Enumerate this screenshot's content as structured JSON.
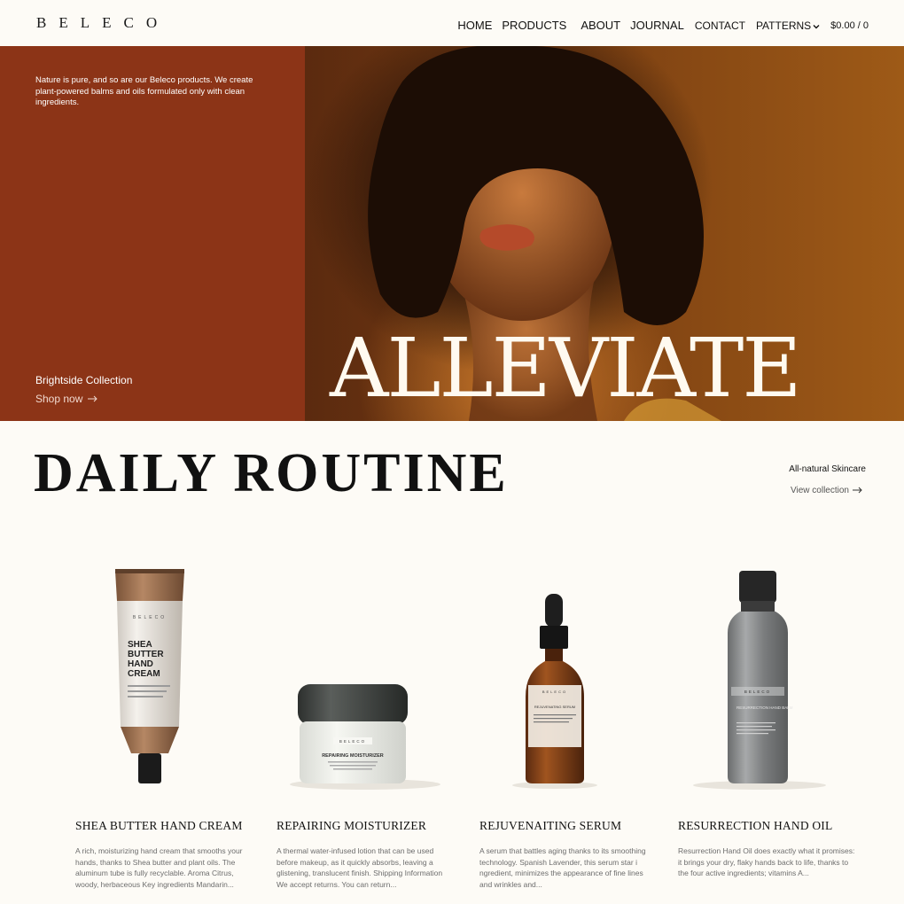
{
  "header": {
    "logo": "BELECO",
    "nav": [
      "HOME",
      "PRODUCTS",
      "ABOUT",
      "JOURNAL",
      "CONTACT",
      "PATTERNS"
    ],
    "cart": "$0.00 / 0"
  },
  "hero": {
    "description": "Nature is pure, and so are our Beleco products. We create plant-powered balms and oils formulated only with clean ingredients.",
    "collection": "Brightside Collection",
    "shop_label": "Shop now",
    "title": "ALLEVIATE"
  },
  "section": {
    "title": "DAILY ROUTINE",
    "side_label": "All-natural Skincare",
    "side_link": "View collection"
  },
  "products": [
    {
      "name": "SHEA BUTTER HAND CREAM",
      "description": "A rich, moisturizing hand cream that smooths your hands, thanks to Shea butter and plant oils. The aluminum tube is fully recyclable. Aroma Citrus, woody, herbaceous Key ingredients Mandarin...",
      "label_lines": [
        "SHEA",
        "BUTTER",
        "HAND",
        "CREAM"
      ],
      "brand": "BELECO"
    },
    {
      "name": "REPAIRING MOISTURIZER",
      "description": "A thermal water-infused lotion that can be used before makeup, as it quickly absorbs, leaving a glistening, translucent finish. Shipping Information We accept returns. You can return...",
      "label": "REPAIRING MOISTURIZER",
      "brand": "BELECO"
    },
    {
      "name": "REJUVENAITING SERUM",
      "description": "A serum that battles aging thanks to its smoothing technology. Spanish Lavender, this serum star i ngredient, minimizes the appearance of fine lines and wrinkles and...",
      "label": "REJUVENATING SERUM",
      "brand": "BELECO"
    },
    {
      "name": "RESURRECTION HAND OIL",
      "description": "Resurrection Hand Oil does exactly what it promises: it brings your dry, flaky hands back to life, thanks to the four active ingredients; vitamins A...",
      "label": "RESURRECTION HAND BALM",
      "brand": "BELECO"
    }
  ],
  "colors": {
    "background": "#fdfbf6",
    "rust": "#8c3417",
    "text": "#1a1a1a"
  }
}
